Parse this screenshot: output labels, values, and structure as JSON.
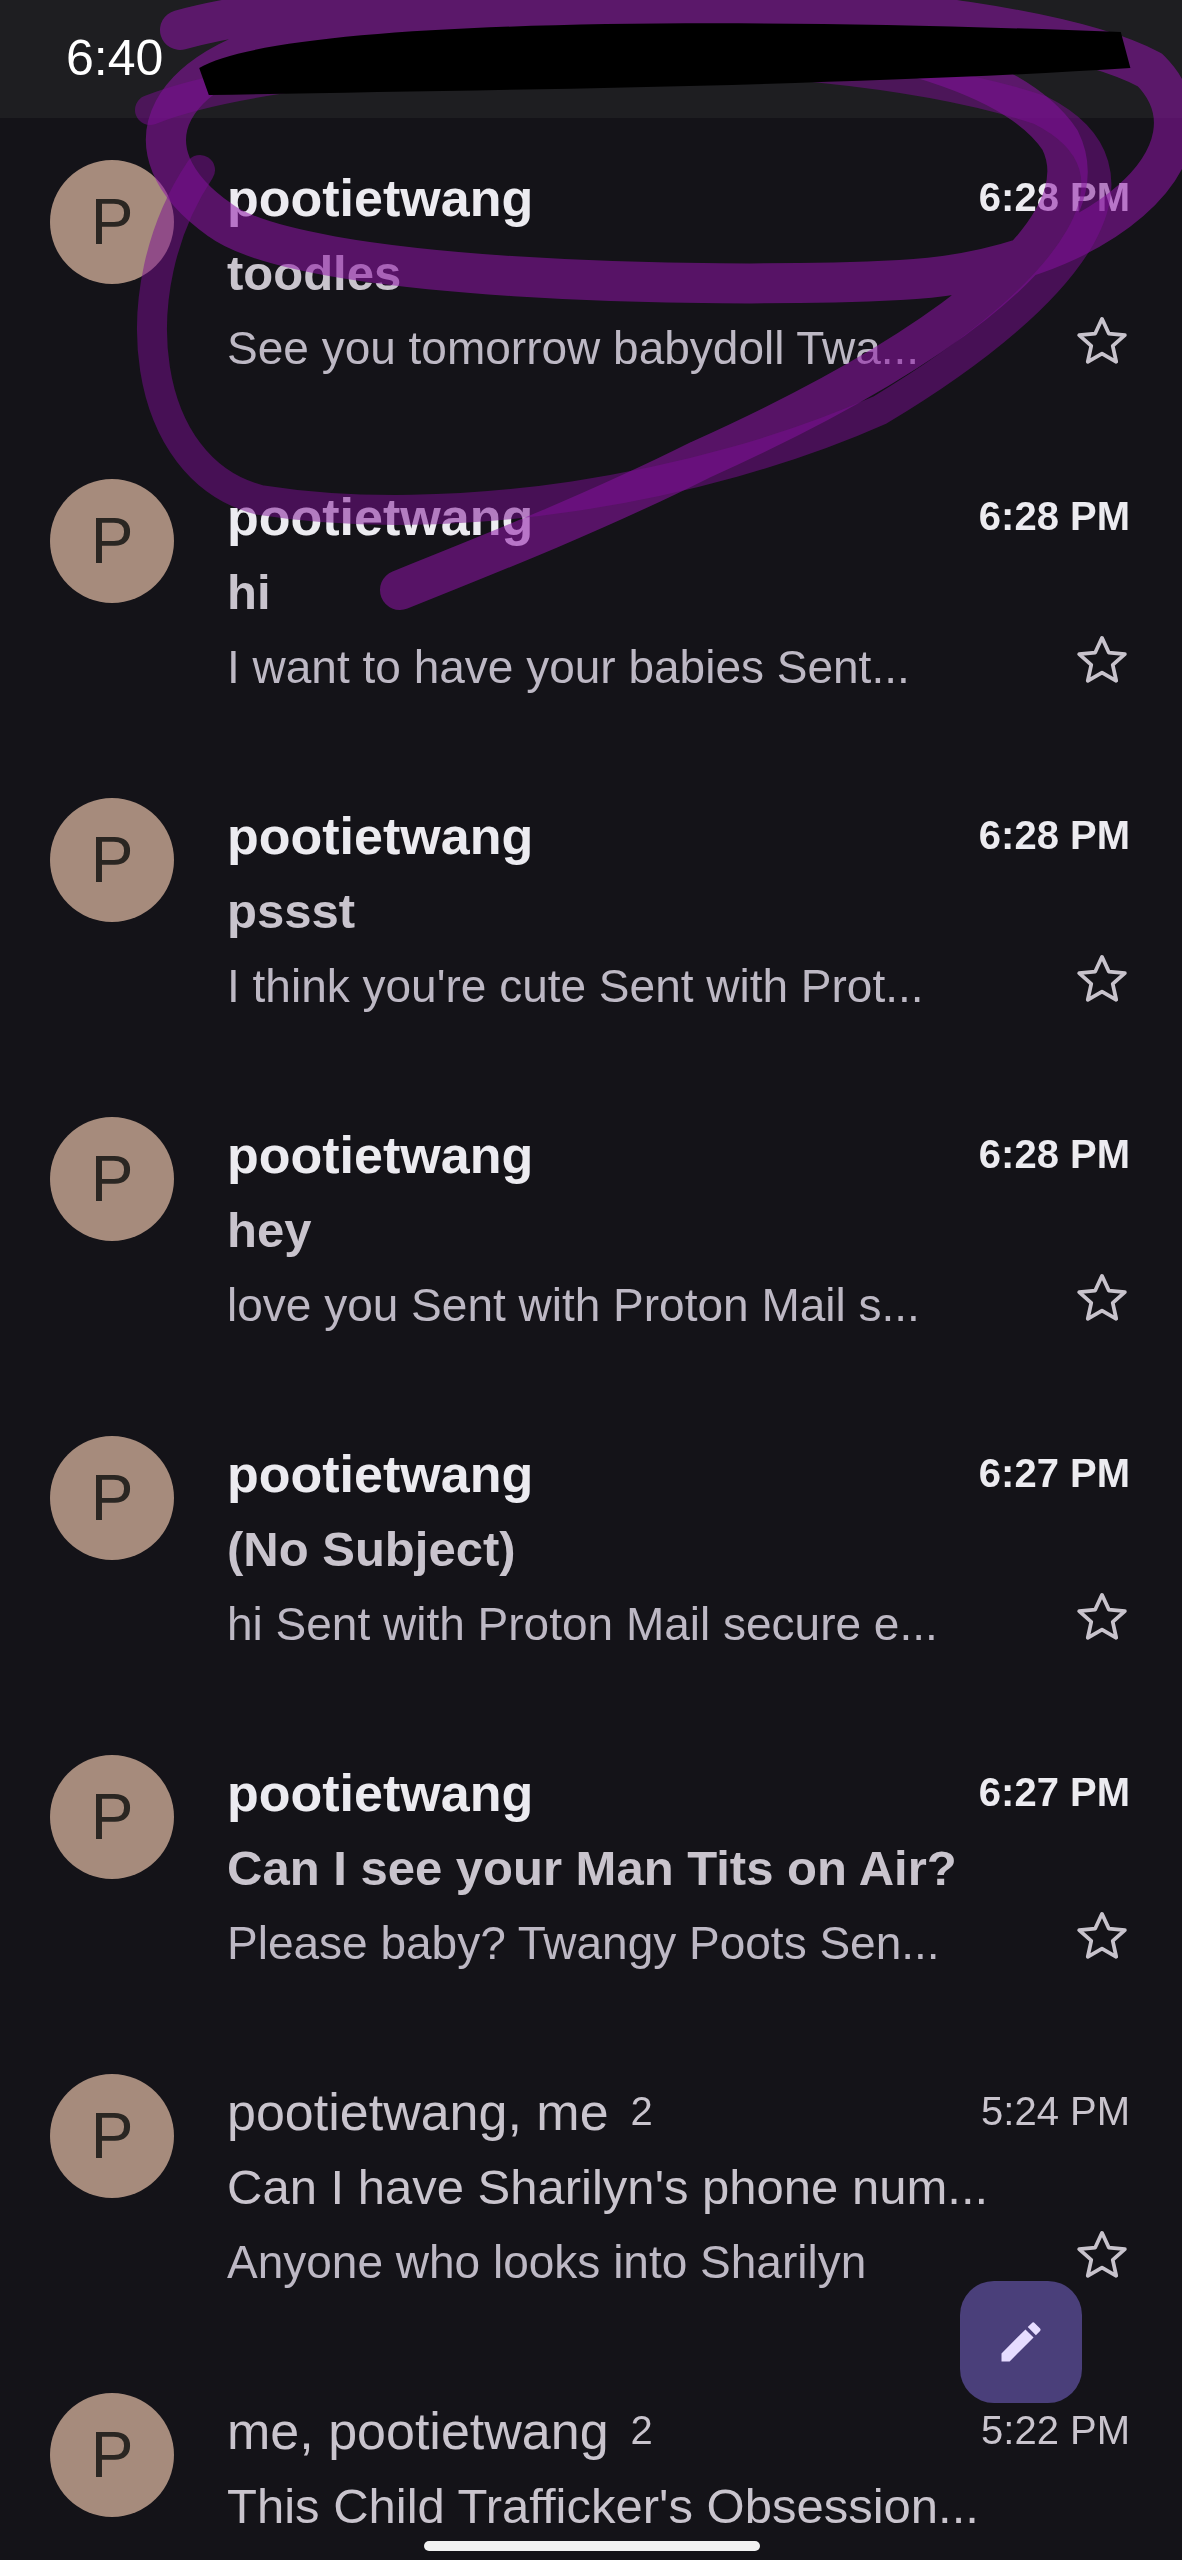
{
  "status_bar": {
    "time": "6:40"
  },
  "emails": [
    {
      "avatar_letter": "P",
      "sender": "pootietwang",
      "subject": "toodles",
      "snippet": "See you tomorrow babydoll Twa...",
      "time": "6:28 PM",
      "unread": true,
      "starred": false
    },
    {
      "avatar_letter": "P",
      "sender": "pootietwang",
      "subject": "hi",
      "snippet": "I want to have your babies Sent...",
      "time": "6:28 PM",
      "unread": true,
      "starred": false
    },
    {
      "avatar_letter": "P",
      "sender": "pootietwang",
      "subject": "pssst",
      "snippet": "I think you're cute Sent with Prot...",
      "time": "6:28 PM",
      "unread": true,
      "starred": false
    },
    {
      "avatar_letter": "P",
      "sender": "pootietwang",
      "subject": "hey",
      "snippet": "love you Sent with Proton Mail s...",
      "time": "6:28 PM",
      "unread": true,
      "starred": false
    },
    {
      "avatar_letter": "P",
      "sender": "pootietwang",
      "subject": "(No Subject)",
      "snippet": "hi Sent with Proton Mail secure e...",
      "time": "6:27 PM",
      "unread": true,
      "starred": false
    },
    {
      "avatar_letter": "P",
      "sender": "pootietwang",
      "subject": "Can I see your Man Tits on Air?",
      "snippet": "Please baby? Twangy Poots Sen...",
      "time": "6:27 PM",
      "unread": true,
      "starred": false
    },
    {
      "avatar_letter": "P",
      "sender": "pootietwang, me",
      "count": "2",
      "subject": "Can I have Sharilyn's phone num...",
      "snippet": "Anyone who looks into Sharilyn",
      "time": "5:24 PM",
      "unread": false,
      "starred": false
    },
    {
      "avatar_letter": "P",
      "sender": "me, pootietwang",
      "count": "2",
      "subject": "This Child Trafficker's Obsession...",
      "time": "5:22 PM",
      "unread": false
    }
  ]
}
